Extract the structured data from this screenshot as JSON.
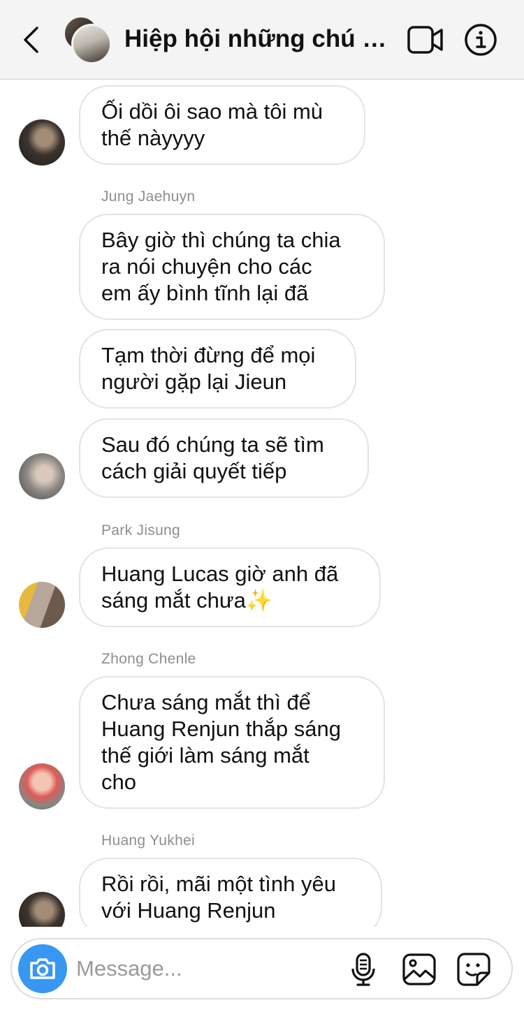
{
  "header": {
    "title": "Hiệp hội những chú h...",
    "icons": {
      "back": "chevron-left-icon",
      "video": "video-camera-icon",
      "info": "info-icon"
    }
  },
  "messages": [
    {
      "sender": "",
      "lines": [
        "Ối dồi ôi sao mà tôi mù",
        "thế nàyyyy"
      ]
    },
    {
      "sender": "Jung Jaehuyn",
      "lines": [
        "Bây giờ thì chúng ta chia",
        "ra nói chuyện cho các",
        "em ấy bình tĩnh lại đã"
      ]
    },
    {
      "sender": "",
      "lines": [
        "Tạm thời đừng để mọi",
        "người gặp lại Jieun"
      ]
    },
    {
      "sender": "",
      "lines": [
        "Sau đó chúng ta sẽ tìm",
        "cách giải quyết tiếp"
      ]
    },
    {
      "sender": "Park Jisung",
      "lines": [
        "Huang Lucas giờ anh đã",
        "sáng mắt chưa✨"
      ]
    },
    {
      "sender": "Zhong Chenle",
      "lines": [
        "Chưa sáng mắt thì để",
        "Huang Renjun thắp sáng",
        "thế giới làm sáng mắt",
        "cho"
      ]
    },
    {
      "sender": "Huang Yukhei",
      "lines": [
        "Rồi rồi, mãi một tình yêu",
        "với Huang Renjun"
      ]
    }
  ],
  "composer": {
    "placeholder": "Message...",
    "icons": {
      "camera": "camera-icon",
      "mic": "microphone-icon",
      "gallery": "image-icon",
      "sticker": "sticker-icon"
    }
  },
  "colors": {
    "accent": "#3897f0",
    "bubble_border": "#e3e3e3",
    "sender_text": "#8e8e8e",
    "header_bg": "#f4f4f4"
  }
}
